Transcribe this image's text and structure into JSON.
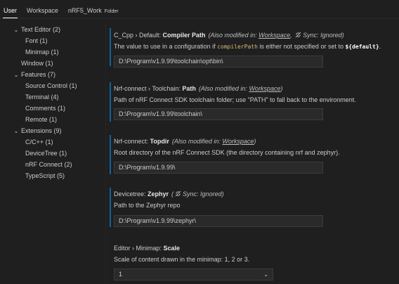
{
  "tabs": [
    {
      "label": "User",
      "active": true
    },
    {
      "label": "Workspace",
      "active": false
    },
    {
      "label": "nRF5_Work",
      "sub": "Folder",
      "active": false
    }
  ],
  "tree": [
    {
      "label": "Text Editor (2)",
      "level": 0,
      "expanded": true
    },
    {
      "label": "Font (1)",
      "level": 1
    },
    {
      "label": "Minimap (1)",
      "level": 1
    },
    {
      "label": "Window (1)",
      "level": 0
    },
    {
      "label": "Features (7)",
      "level": 0,
      "expanded": true
    },
    {
      "label": "Source Control (1)",
      "level": 1
    },
    {
      "label": "Terminal (4)",
      "level": 1
    },
    {
      "label": "Comments (1)",
      "level": 1
    },
    {
      "label": "Remote (1)",
      "level": 1
    },
    {
      "label": "Extensions (9)",
      "level": 0,
      "expanded": true
    },
    {
      "label": "C/C++ (1)",
      "level": 1
    },
    {
      "label": "DeviceTree (1)",
      "level": 1
    },
    {
      "label": "nRF Connect (2)",
      "level": 1
    },
    {
      "label": "TypeScript (5)",
      "level": 1
    }
  ],
  "settings": {
    "cpp": {
      "prefix": "C_Cpp › Default: ",
      "name": "Compiler Path",
      "meta_open": "(Also modified in: ",
      "meta_link": "Workspace",
      "meta_sync": ", ",
      "meta_sync_text": "Sync: Ignored)",
      "desc_1": "The value to use in a configuration if ",
      "desc_code": "compilerPath",
      "desc_2": " is either not specified or set to ",
      "desc_code2": "${default}",
      "desc_3": ".",
      "value": "D:\\Program\\v1.9.99\\toolchain\\opt\\bin\\"
    },
    "toolchain": {
      "prefix": "Nrf-connect › Toolchain: ",
      "name": "Path",
      "meta_open": "(Also modified in: ",
      "meta_link": "Workspace",
      "meta_close": ")",
      "desc": "Path of nRF Connect SDK toolchain folder; use \"PATH\" to fall back to the environment.",
      "value": "D:\\Program\\v1.9.99\\toolchain\\"
    },
    "topdir": {
      "prefix": "Nrf-connect: ",
      "name": "Topdir",
      "meta_open": "(Also modified in: ",
      "meta_link": "Workspace",
      "meta_close": ")",
      "desc": "Root directory of the nRF Connect SDK (the directory containing nrf and zephyr).",
      "value": "D:\\Program\\v1.9.99\\"
    },
    "zephyr": {
      "prefix": "Devicetree: ",
      "name": "Zephyr",
      "meta_open": "(",
      "meta_sync_text": "Sync: Ignored)",
      "desc": "Path to the Zephyr repo",
      "value": "D:\\Program\\v1.9.99\\zephyr\\"
    },
    "minimap": {
      "prefix": "Editor › Minimap: ",
      "name": "Scale",
      "desc": "Scale of content drawn in the minimap: 1, 2 or 3.",
      "value": "1"
    }
  },
  "colors": {
    "accent": "#0e639c",
    "background": "#1f1f1f",
    "input_bg": "#2a2a2a"
  }
}
